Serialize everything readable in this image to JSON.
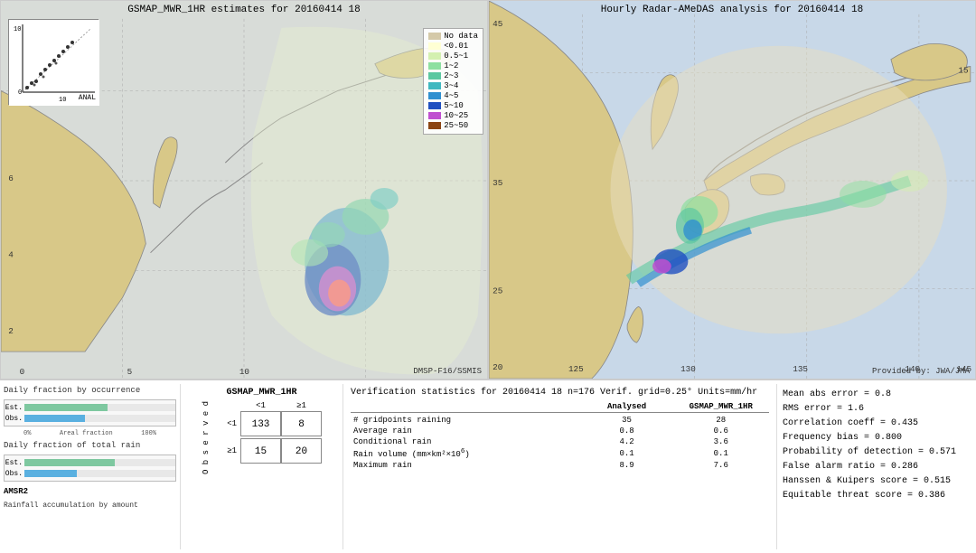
{
  "left_map": {
    "title": "GSMAP_MWR_1HR estimates for 20160414 18",
    "bottom_label": "DMSP-F16/SSMIS",
    "inset_label": "ANAL"
  },
  "right_map": {
    "title": "Hourly Radar-AMeDAS analysis for 20160414 18",
    "bottom_label": "Provided by: JWA/JMA"
  },
  "legend": {
    "items": [
      {
        "label": "No data",
        "color": "#d4c9a8"
      },
      {
        "label": "<0.01",
        "color": "#ffffd4"
      },
      {
        "label": "0.5~1",
        "color": "#d4f0b0"
      },
      {
        "label": "1~2",
        "color": "#8ee0a0"
      },
      {
        "label": "2~3",
        "color": "#5cc8a0"
      },
      {
        "label": "3~4",
        "color": "#40b8c0"
      },
      {
        "label": "4~5",
        "color": "#3090d0"
      },
      {
        "label": "5~10",
        "color": "#2050c0"
      },
      {
        "label": "10~25",
        "color": "#c050d0"
      },
      {
        "label": "25~50",
        "color": "#8b4513"
      }
    ]
  },
  "charts": {
    "section_label": "AMSR2",
    "daily_occurrence_label": "Daily fraction by occurrence",
    "daily_rain_label": "Daily fraction of total rain",
    "rainfall_label": "Rainfall accumulation by amount",
    "est_label": "Est.",
    "obs_label": "Obs.",
    "pct_0": "0%",
    "pct_100": "100%",
    "areal_fraction": "Areal fraction",
    "est_bar1_pct": 55,
    "obs_bar1_pct": 40,
    "est_bar2_pct": 60,
    "obs_bar2_pct": 35,
    "est_bar1_color": "#7ec8a0",
    "obs_bar1_color": "#5ab0e0",
    "est_bar2_color": "#7ec8a0",
    "obs_bar2_color": "#5ab0e0"
  },
  "contingency": {
    "title": "GSMAP_MWR_1HR",
    "obs_label": "O b s e r v e d",
    "col_header_lt1": "<1",
    "col_header_ge1": "≥1",
    "row_lt1": "<1",
    "row_ge1": "≥1",
    "cell_lt1_lt1": "133",
    "cell_lt1_ge1": "8",
    "cell_ge1_lt1": "15",
    "cell_ge1_ge1": "20"
  },
  "verification": {
    "title": "Verification statistics for 20160414 18  n=176  Verif. grid=0.25°  Units=mm/hr",
    "col_analyzed": "Analysed",
    "col_gsmap": "GSMAP_MWR_1HR",
    "divider": "------------------------------------------------------------",
    "rows": [
      {
        "label": "# gridpoints raining",
        "analyzed": "35",
        "gsmap": "28"
      },
      {
        "label": "Average rain",
        "analyzed": "0.8",
        "gsmap": "0.6"
      },
      {
        "label": "Conditional rain",
        "analyzed": "4.2",
        "gsmap": "3.6"
      },
      {
        "label": "Rain volume (mm×km²×10⁶)",
        "analyzed": "0.1",
        "gsmap": "0.1"
      },
      {
        "label": "Maximum rain",
        "analyzed": "8.9",
        "gsmap": "7.6"
      }
    ]
  },
  "metrics": {
    "mean_abs_error": "Mean abs error = 0.8",
    "rms_error": "RMS error = 1.6",
    "correlation": "Correlation coeff = 0.435",
    "freq_bias": "Frequency bias = 0.800",
    "prob_detection": "Probability of detection = 0.571",
    "false_alarm": "False alarm ratio = 0.286",
    "hanssen_kuipers": "Hanssen & Kuipers score = 0.515",
    "equitable_threat": "Equitable threat score = 0.386"
  }
}
